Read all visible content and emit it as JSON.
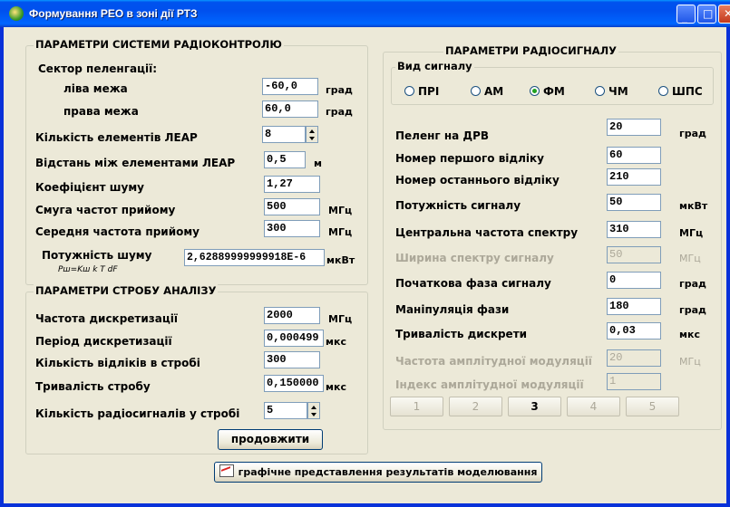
{
  "window": {
    "title": "Формування РЕО в зоні дії РТЗ"
  },
  "left_group": {
    "title": "ПАРАМЕТРИ СИСТЕМИ РАДІОКОНТРОЛЮ",
    "sector_label": "Сектор пеленгації:",
    "left_label": "ліва межа",
    "left_value": "-60,0",
    "left_unit": "град",
    "right_label": "права межа",
    "right_value": "60,0",
    "right_unit": "град",
    "count_label": "Кількість елементів ЛЕАР",
    "count_value": "8",
    "distance_label": "Відстань між елементами ЛЕАР",
    "distance_value": "0,5",
    "distance_unit": "м",
    "noise_coef_label": "Коефіцієнт шуму",
    "noise_coef_value": "1,27",
    "band_label": "Смуга частот прийому",
    "band_value": "500",
    "band_unit": "МГц",
    "center_label": "Середня частота прийому",
    "center_value": "300",
    "center_unit": "МГц",
    "noise_power_label": "Потужність шуму",
    "noise_power_value": "2,62889999999918E-6",
    "noise_power_unit": "мкВт",
    "noise_formula": "Pш=Kш k T dF"
  },
  "strobe_group": {
    "title": "ПАРАМЕТРИ СТРОБУ АНАЛІЗУ",
    "sampling_freq_label": "Частота дискретизації",
    "sampling_freq_value": "2000",
    "sampling_freq_unit": "МГц",
    "period_label": "Період дискретизації",
    "period_value": "0,000499",
    "period_unit": "мкс",
    "samples_label": "Кількість відліків в стробі",
    "samples_value": "300",
    "duration_label": "Тривалість стробу",
    "duration_value": "0,150000",
    "duration_unit": "мкс",
    "signals_label": "Кількість радіосигналів у стробі",
    "signals_value": "5",
    "continue_label": "продовжити"
  },
  "radio_group": {
    "title": "ПАРАМЕТРИ РАДІОСИГНАЛУ",
    "type_title": "Вид сигналу",
    "types": [
      "ПРІ",
      "АМ",
      "ФМ",
      "ЧМ",
      "ШПС"
    ],
    "selected_type": "ФМ",
    "bearing_label": "Пеленг  на  ДРВ",
    "bearing_value": "20",
    "bearing_unit": "град",
    "first_label": "Номер першого відліку",
    "first_value": "60",
    "last_label": "Номер останнього відліку",
    "last_value": "210",
    "power_label": "Потужність сигналу",
    "power_value": "50",
    "power_unit": "мкВт",
    "center_label": "Центральна частота спектру",
    "center_value": "310",
    "center_unit": "МГц",
    "width_label": "Ширина спектру сигналу",
    "width_value": "50",
    "width_unit": "МГц",
    "phase_label": "Початкова фаза сигналу",
    "phase_value": "0",
    "phase_unit": "град",
    "manip_label": "Маніпуляція фази",
    "manip_value": "180",
    "manip_unit": "град",
    "discrete_label": "Тривалість дискрети",
    "discrete_value": "0,03",
    "discrete_unit": "мкс",
    "am_freq_label": "Частота амплітудної модуляції",
    "am_freq_value": "20",
    "am_freq_unit": "МГц",
    "am_index_label": "Індекс амплітудної модуляції",
    "am_index_value": "1",
    "signal_buttons": [
      "1",
      "2",
      "3",
      "4",
      "5"
    ],
    "active_signal": "3"
  },
  "graph_button_label": "графічне представлення результатів моделювання"
}
